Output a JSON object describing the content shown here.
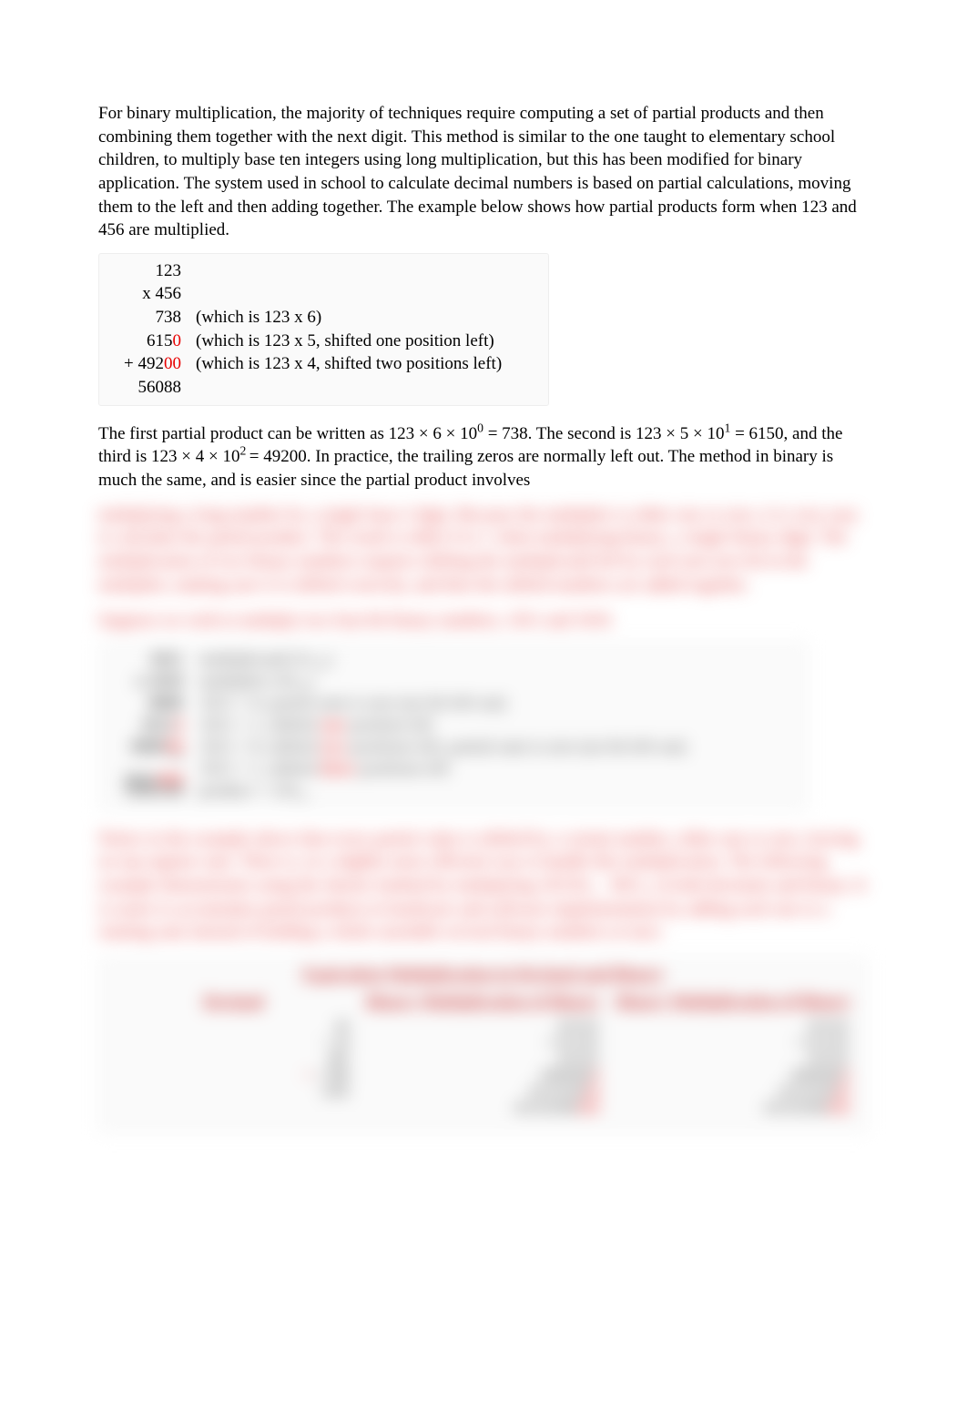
{
  "para1": "For binary multiplication, the majority of techniques require computing a set of partial products and then combining them together with the next digit. This method is similar to the one taught to elementary school children, to multiply base ten integers using long multiplication, but this has been modified for binary application. The system used in school to calculate decimal numbers is based on partial calculations, moving them to the left and then adding together. The example below shows how partial products form when 123 and 456 are multiplied.",
  "calc1": {
    "r1": "123",
    "r2": "x 456",
    "r3": "738",
    "r3desc": "(which is 123 x 6)",
    "r4_black": "615",
    "r4_red": "0",
    "r4desc": "(which is 123 x 5, shifted one position left)",
    "r5_prefix": "+ 492",
    "r5_red": "00",
    "r5desc": "(which is 123 x 4, shifted two positions left)",
    "r6": "56088"
  },
  "para2_a": "The first partial product can be written as 123 × 6 × 10",
  "para2_sup0": "0",
  "para2_b": " = 738. The second is 123 × 5 × 10",
  "para2_sup1": "1",
  "para2_c": " = 6150, and the third is 123 × 4 × 10",
  "para2_sup2": "2 ",
  "para2_d": "= 49200. In practice, the trailing zeros are normally left out. The method in binary is much the same, and is easier since the partial product involves",
  "blur": {
    "p1": "multiplying a long number by a single base-2 digit. Because the multiplier is either one or zero, it is very easy to calculate the partial product. The result is either 0 or 1 when multiplying binary, a single binary digit. The multiplication of two binary numbers requires shifting the multiplicand left by each non-zero bit in the multiplier, making sure it is shifted correctly, and then the shifted numbers are added together.",
    "p2": "Suppose we wish to multiply two four-bit binary numbers, 1011 and 1010.",
    "box_rows": [
      {
        "num": "1011",
        "desc": "multiplicand (11₁₀)"
      },
      {
        "num": "x 1010",
        "desc": "multiplier (10₁₀)"
      },
      {
        "num": "0000",
        "desc": "1011 × 0, partial sum is zero (no bit left out)"
      },
      {
        "num_black": "1011",
        "num_red": "0",
        "desc_a": "1011 × 1, shifted ",
        "desc_red": "one",
        "desc_b": " position left"
      },
      {
        "num_black": "0000",
        "num_red": "00",
        "desc_a": "1011 × 0, shifted ",
        "desc_red": "two",
        "desc_b": " positions left, partial sum is zero (no bit left out)"
      },
      {
        "num_black": "+ 1011",
        "num_red": "000",
        "desc_a": "1011 × 1, shifted ",
        "desc_red": "three",
        "desc_b": " positions left"
      },
      {
        "num": "1101110",
        "desc": "product = 110₁₀"
      }
    ],
    "p3": "Notice in the example above that every partial value is shifted by a certain number, either one or zero, leaving no top register sum. There is, in a slightly more efficient way to handle this multiplication. The following example demonstrates using the shorter method by multiplying 101101₂ · 0011₂ in both decimals and binary. It is easier to accumulate partial products in hardware and software implementation by adding each one to a running sum instead of holding a whole assemble several binary numbers at once.",
    "table": {
      "title": "Equivalent Multiplication in Decimal and Binary",
      "headers": [
        "Decimal",
        "Binary Multiplication of Binary",
        "Binary Multiplication of Binary"
      ],
      "col1": [
        "45",
        "× 29",
        "405",
        "+ 900",
        "1305",
        ""
      ],
      "col2": [
        "101101",
        "× 011101",
        "101101",
        "0000000",
        "10110100",
        "101101000",
        "10110100000"
      ],
      "col3": [
        "101101",
        "× 011101",
        "101101",
        "0000000",
        "10110100",
        "101101000",
        "10110100000"
      ]
    }
  }
}
